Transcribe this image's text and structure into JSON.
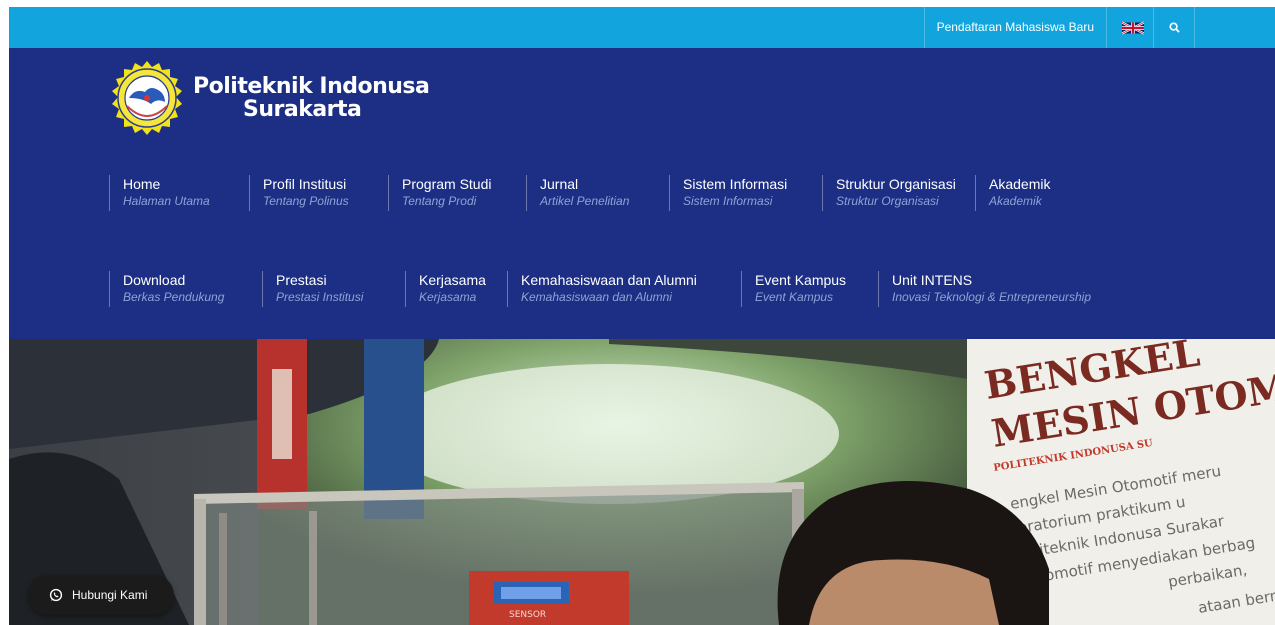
{
  "topbar": {
    "registration_link": "Pendaftaran Mahasiswa Baru",
    "language_flag_icon": "uk-flag-icon",
    "search_icon": "search-icon"
  },
  "logo": {
    "name_line1": "Politeknik Indonusa",
    "name_line2": "Surakarta",
    "emblem_icon": "politeknik-emblem-logo"
  },
  "nav": {
    "row1": [
      {
        "title": "Home",
        "subtitle": "Halaman Utama"
      },
      {
        "title": "Profil Institusi",
        "subtitle": "Tentang Polinus"
      },
      {
        "title": "Program Studi",
        "subtitle": "Tentang Prodi"
      },
      {
        "title": "Jurnal",
        "subtitle": "Artikel Penelitian"
      },
      {
        "title": "Sistem Informasi",
        "subtitle": "Sistem Informasi"
      },
      {
        "title": "Struktur Organisasi",
        "subtitle": "Struktur Organisasi"
      },
      {
        "title": "Akademik",
        "subtitle": "Akademik"
      }
    ],
    "row2": [
      {
        "title": "Download",
        "subtitle": "Berkas Pendukung"
      },
      {
        "title": "Prestasi",
        "subtitle": "Prestasi Institusi"
      },
      {
        "title": "Kerjasama",
        "subtitle": "Kerjasama"
      },
      {
        "title": "Kemahasiswaan dan Alumni",
        "subtitle": "Kemahasiswaan dan Alumni"
      },
      {
        "title": "Event Kampus",
        "subtitle": "Event Kampus"
      },
      {
        "title": "Unit INTENS",
        "subtitle": "Inovasi Teknologi & Entrepreneurship"
      }
    ]
  },
  "hero": {
    "banner_line1": "BENGKEL",
    "banner_line2": "MESIN OTOM",
    "banner_line3": "POLITEKNIK INDONUSA SU",
    "banner_body": [
      "engkel Mesin Otomotif meru",
      "oratorium praktikum u",
      "oliteknik Indonusa Surakar",
      "otomotif menyediakan berbag",
      "perbaikan,",
      "ataan bermot"
    ],
    "device_label": "SENSOR"
  },
  "whatsapp": {
    "label": "Hubungi Kami",
    "icon": "whatsapp-icon"
  },
  "colors": {
    "topbar": "#12a4dc",
    "header": "#1c2f84",
    "nav_subtitle": "#8fa3d6"
  }
}
